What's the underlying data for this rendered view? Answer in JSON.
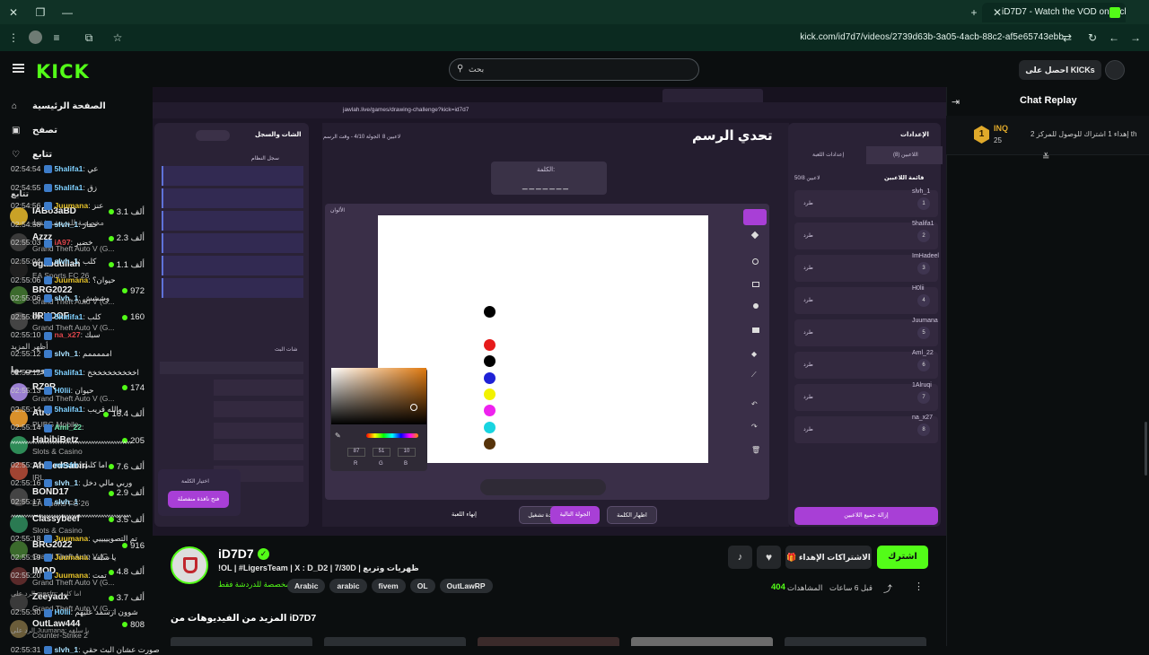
{
  "browser": {
    "active_tab_title": "iD7D7 - Watch the VOD on Kick",
    "url": "kick.com/id7d7/videos/2739d63b-3a05-4acb-88c2-af5e65743ebb"
  },
  "kick": {
    "logo": "KICK",
    "search_placeholder": "بحث",
    "kicks_button": "احصل على KICKs",
    "nav": [
      {
        "label": "الصفحة الرئيسية",
        "icon": "home-icon"
      },
      {
        "label": "تصفح",
        "icon": "browse-icon"
      },
      {
        "label": "تتابع",
        "icon": "heart-icon"
      }
    ],
    "following_title": "تتابع",
    "show_more": "أظهر المزيد",
    "recommended_title": "موصى بها",
    "following": [
      {
        "name": "IABo3aBD",
        "game": "مخصصة للدردشة فقط",
        "viewers": "3.1 ألف",
        "color": "#c9a227"
      },
      {
        "name": "Azzz",
        "game": "Grand Theft Auto V (G...",
        "viewers": "2.3 ألف",
        "color": "#3a3a3a"
      },
      {
        "name": "ogabdullah",
        "game": "EA Sports FC 26",
        "viewers": "1.1 ألف",
        "color": "#1f1f1f"
      },
      {
        "name": "BRG2022",
        "game": "Grand Theft Auto V (G...",
        "viewers": "972",
        "color": "#3b6a2c"
      },
      {
        "name": "IIRYOOF",
        "game": "Grand Theft Auto V (G...",
        "viewers": "160",
        "color": "#444"
      }
    ],
    "recommended": [
      {
        "name": "RZ9R",
        "game": "Grand Theft Auto V (G...",
        "viewers": "174",
        "color": "#9a7fd1"
      },
      {
        "name": "Atro",
        "game": "PUBG Mobile",
        "viewers": "16.4 ألف",
        "color": "#d9902a"
      },
      {
        "name": "HabibiBetz",
        "game": "Slots & Casino",
        "viewers": "205",
        "color": "#2e8b57"
      },
      {
        "name": "AhmedSabiri",
        "game": "IRL",
        "viewers": "7.6 ألف",
        "color": "#a04432"
      },
      {
        "name": "BOND17",
        "game": "EA Sports FC 26",
        "viewers": "2.9 ألف",
        "color": "#444"
      },
      {
        "name": "Classybeef",
        "game": "Slots & Casino",
        "viewers": "3.5 ألف",
        "color": "#2a7a52"
      },
      {
        "name": "BRG2022",
        "game": "Grand Theft Auto V (G...",
        "viewers": "916",
        "color": "#3b6a2c"
      },
      {
        "name": "IMOD",
        "game": "Grand Theft Auto V (G...",
        "viewers": "4.8 ألف",
        "color": "#5a2a2a"
      },
      {
        "name": "Zeeyadx",
        "game": "Grand Theft Auto V (G...",
        "viewers": "3.7 ألف",
        "color": "#3a3a3a"
      },
      {
        "name": "OutLaw444",
        "game": "Counter-Strike 2",
        "viewers": "808",
        "color": "#6b5d3a"
      }
    ]
  },
  "game": {
    "window_url": "jawlah.live/games/drawing-challenge?kick=id7d7",
    "title": "تحدي الرسم",
    "word_label": "الكلمة:",
    "word_blanks": "_______",
    "round_info": "الجولة 4/10 - وقت الرسم",
    "players_count": "8 لاعبين",
    "colors_label": "الألوان",
    "rgb": [
      "87",
      "51",
      "10"
    ],
    "rgb_labels": [
      "R",
      "G",
      "B"
    ],
    "settings_title": "الإعدادات",
    "tab_players": "اللاعبين (8)",
    "tab_game_settings": "إعدادات اللعبة",
    "players_list_title": "قائمة اللاعبين",
    "players_cap": "50/8 لاعبين",
    "players": [
      "slvh_1",
      "5halifa1",
      "ImHadeel",
      "H0lii",
      "Juumana",
      "Aml_22",
      "1Alruqi",
      "na_x27"
    ],
    "kick_label": "طرد",
    "remove_all": "إزالة جميع اللاعبين",
    "chat_title": "الشات والسجل",
    "system_log": "سجل النظام",
    "chat_section": "شات البث",
    "choose_word": "اختيار الكلمة",
    "open_window": "فتح نافذة منفصلة",
    "buttons": [
      "إنهاء اللعبة",
      "إعادة تشغيل",
      "الجولة التالية",
      "اظهار الكلمة"
    ]
  },
  "stream": {
    "channel": "iD7D7",
    "title": "!OL | #LigersTeam | X : D_D2 | 7/30D | ظهريات وتربع",
    "category": "مخصصة للدردشة فقط",
    "tags": [
      "Arabic",
      "arabic",
      "fivem",
      "OL",
      "OutLawRP"
    ],
    "subscribe": "اشترك",
    "gift": "الاشتراكات الإهداء",
    "views": "404",
    "views_label": "المشاهدات",
    "time_ago": "قبل 6 ساعات",
    "more_videos": "المزيد من الفيديوهات من iD7D7"
  },
  "chat": {
    "title": "Chat Replay",
    "pinned_user": "INQ",
    "pinned_rank": "1",
    "pinned_count": "25",
    "pinned_text": "إهداء 1 اشتراك للوصول للمركز 2 th",
    "messages": [
      {
        "time": "02:54:54",
        "user": "5halifa1",
        "text": "عي",
        "color": "#7fd0ff"
      },
      {
        "time": "02:54:55",
        "user": "5halifa1",
        "text": "زق",
        "color": "#7fd0ff"
      },
      {
        "time": "02:54:56",
        "user": "Juumana",
        "text": "عنز",
        "color": "#e6c229"
      },
      {
        "time": "02:54:58",
        "user": "slvh_1",
        "text": "حمار",
        "color": "#a8e0ff"
      },
      {
        "time": "02:55:03",
        "user": "iA97",
        "text": "خضير",
        "color": "#e0454b"
      },
      {
        "time": "02:55:04",
        "user": "slvh_1",
        "text": "كلب",
        "color": "#a8e0ff"
      },
      {
        "time": "02:55:06",
        "user": "Juumana",
        "text": "حيوان؟",
        "color": "#e6c229"
      },
      {
        "time": "02:55:06",
        "user": "slvh_1",
        "text": "وششش",
        "color": "#a8e0ff"
      },
      {
        "time": "02:55:09",
        "user": "5halifa1",
        "text": "كلب",
        "color": "#7fd0ff"
      },
      {
        "time": "02:55:10",
        "user": "na_x27",
        "text": "سبك",
        "color": "#e0454b"
      },
      {
        "time": "02:55:12",
        "user": "slvh_1",
        "text": "امممممم",
        "color": "#a8e0ff"
      },
      {
        "time": "02:55:12",
        "user": "5halifa1",
        "text": "اخخخخخخخخخخ",
        "color": "#7fd0ff"
      },
      {
        "time": "02:55:13",
        "user": "H0lii",
        "text": "حيوان",
        "color": "#7fd0ff"
      },
      {
        "time": "02:55:14",
        "user": "5halifa1",
        "text": "والله قريب",
        "color": "#7fd0ff"
      },
      {
        "time": "02:55:14",
        "user": "Aml_22",
        "text": "",
        "color": "#6fe0a8"
      },
      {
        "time": "",
        "user": "",
        "text": "^^^^^^^^^^^^^^^^^^^^^^^^^^^^^^^^^^^^^^^^^^^^^^^^",
        "color": "#ffffff"
      },
      {
        "time": "02:55:14",
        "user": "mesfrr",
        "text": "اما كلب",
        "color": "#7fd0ff"
      },
      {
        "time": "02:55:16",
        "user": "slvh_1",
        "text": "وربي مالي دخل",
        "color": "#a8e0ff"
      },
      {
        "time": "02:55:17",
        "user": "slvh_1",
        "text": "",
        "color": "#a8e0ff"
      },
      {
        "time": "",
        "user": "",
        "text": "^^^^^^^^^^^^^^^^^^^^^^^^^^^^^^^^^^^^^^^^^^^^^^^^",
        "color": "#ffffff"
      },
      {
        "time": "02:55:18",
        "user": "Juumana",
        "text": "تم التصويييييي",
        "color": "#e6c229"
      },
      {
        "time": "02:55:19",
        "user": "Juumana",
        "text": "يا سلفه",
        "color": "#e6c229"
      },
      {
        "time": "02:55:20",
        "user": "Juumana",
        "text": "تمت",
        "color": "#e6c229"
      },
      {
        "time": "",
        "user": "",
        "text": "الرد على mesfrr: اما كلب",
        "color": "#9a9a9a"
      },
      {
        "time": "02:55:30",
        "user": "H0lii",
        "text": "شوون ارسمد عليهم",
        "color": "#7fd0ff"
      },
      {
        "time": "",
        "user": "",
        "text": "الرد على Juumana: يا سلفه",
        "color": "#9a9a9a"
      },
      {
        "time": "02:55:31",
        "user": "slvh_1",
        "text": "صورت عشان البث حقي",
        "color": "#a8e0ff"
      }
    ]
  },
  "colors": {
    "kick_green": "#53fc18",
    "accent_purple": "#a83fd6"
  }
}
